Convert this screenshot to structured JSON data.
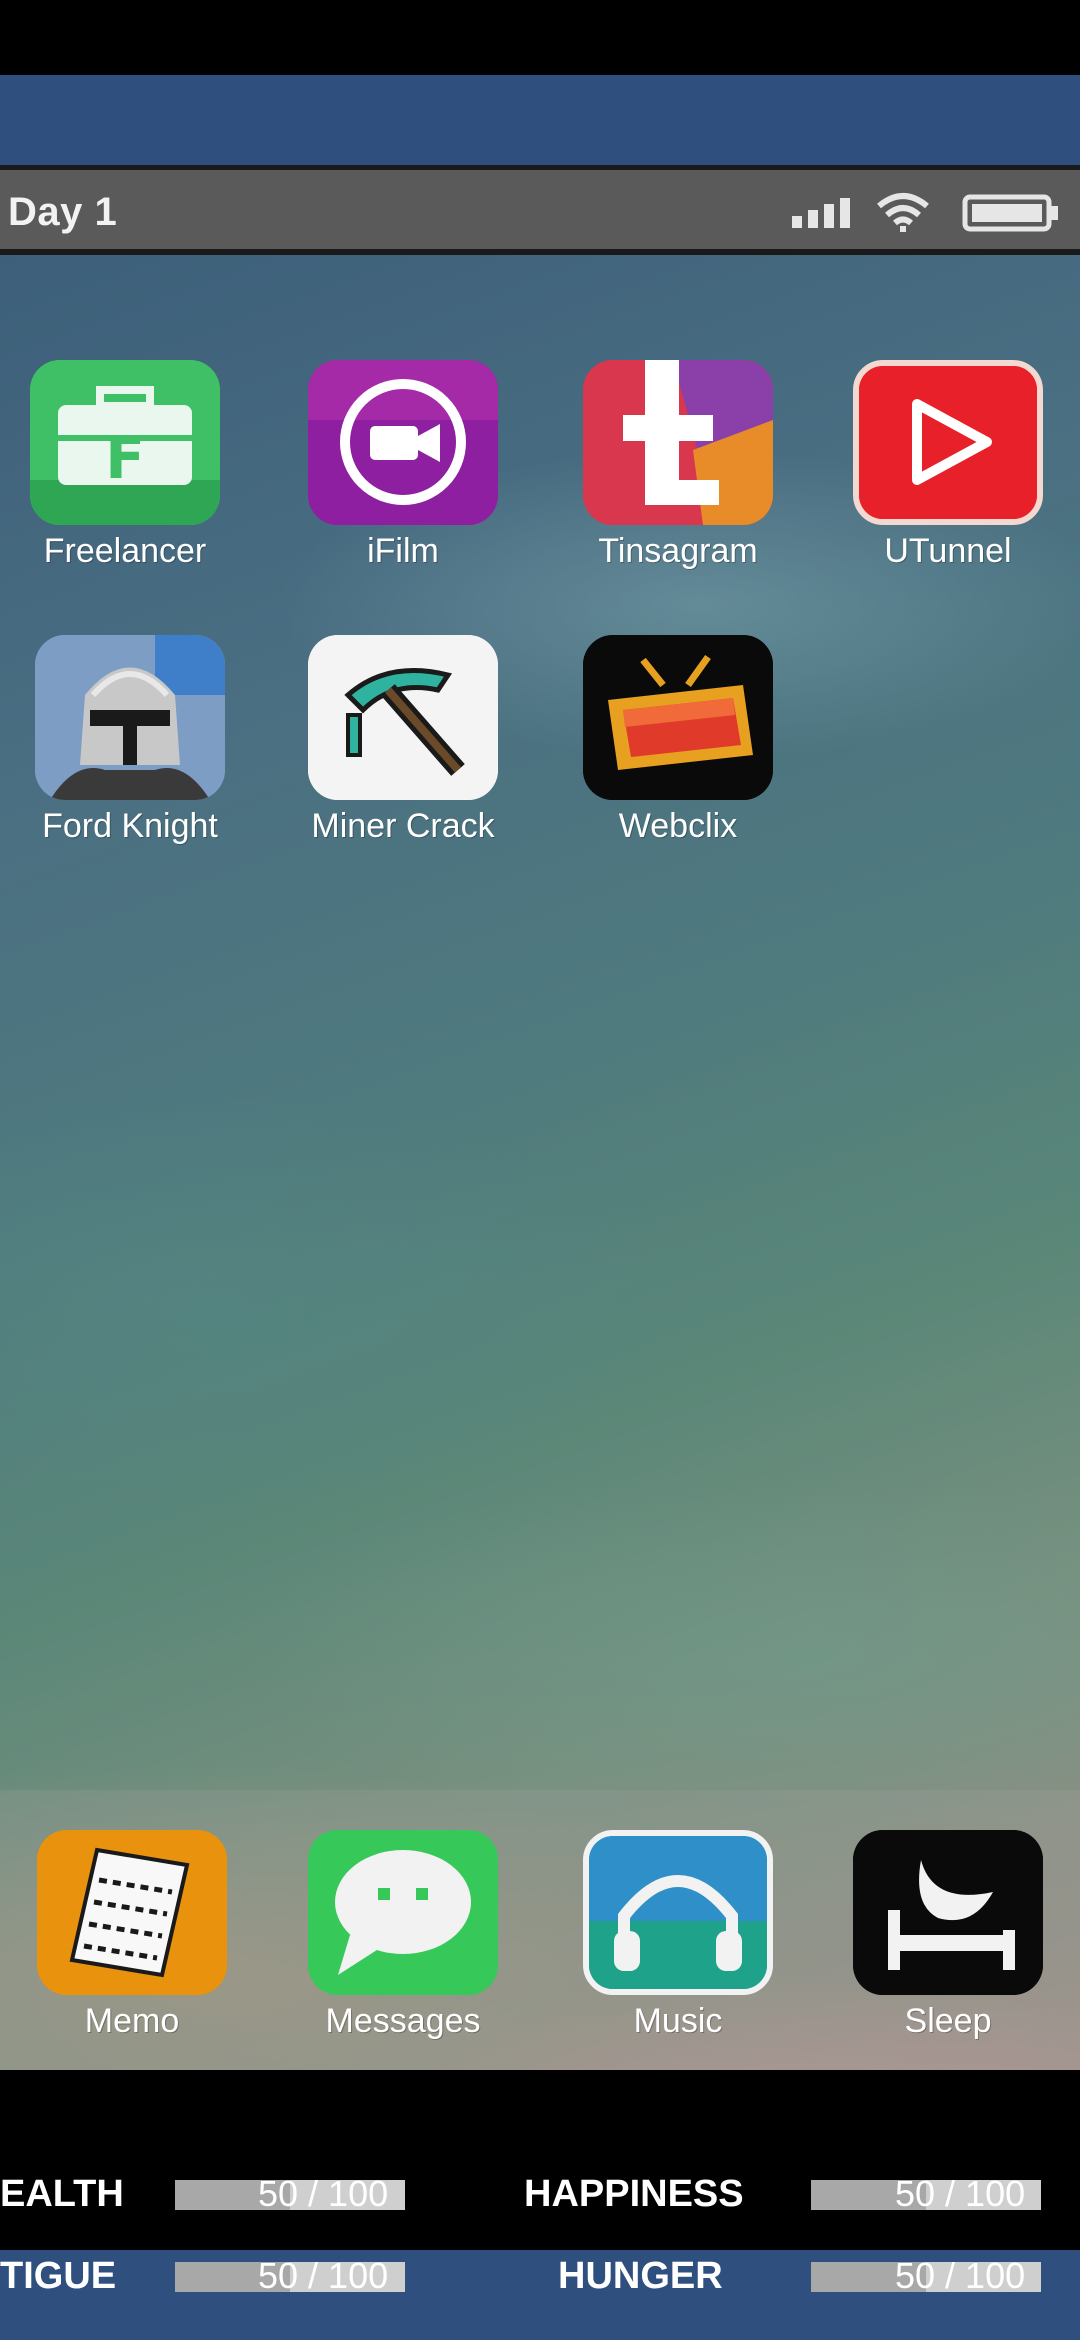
{
  "status_bar": {
    "day": "Day 1"
  },
  "apps": [
    {
      "name": "Freelancer",
      "icon": "freelancer-briefcase-icon",
      "color": "#3fbf66"
    },
    {
      "name": "iFilm",
      "icon": "ifilm-camera-icon",
      "color": "#8e1fa0"
    },
    {
      "name": "Tinsagram",
      "icon": "tinsagram-t-icon",
      "color": "#e83a4a"
    },
    {
      "name": "UTunnel",
      "icon": "utunnel-play-icon",
      "color": "#e8202a"
    },
    {
      "name": "Ford Knight",
      "icon": "ford-knight-helmet-icon",
      "color": "#8aa6c8"
    },
    {
      "name": "Miner Crack",
      "icon": "miner-crack-pickaxe-icon",
      "color": "#f4f4f4"
    },
    {
      "name": "Webclix",
      "icon": "webclix-tv-icon",
      "color": "#0a0a0a"
    }
  ],
  "dock": [
    {
      "name": "Memo",
      "icon": "memo-notepad-icon",
      "color": "#e8920e"
    },
    {
      "name": "Messages",
      "icon": "messages-bubble-icon",
      "color": "#36c95a"
    },
    {
      "name": "Music",
      "icon": "music-headphones-icon",
      "color": "#2f8fc8"
    },
    {
      "name": "Sleep",
      "icon": "sleep-bed-moon-icon",
      "color": "#0a0a0a"
    }
  ],
  "stats": [
    {
      "label": "EALTH",
      "value_text": "50 / 100",
      "level": 0.5
    },
    {
      "label": "HAPPINESS",
      "value_text": "50 / 100",
      "level": 0.5
    },
    {
      "label": "TIGUE",
      "value_text": "50 / 100",
      "level": 0.5
    },
    {
      "label": "HUNGER",
      "value_text": "50 / 100",
      "level": 0.5
    }
  ]
}
